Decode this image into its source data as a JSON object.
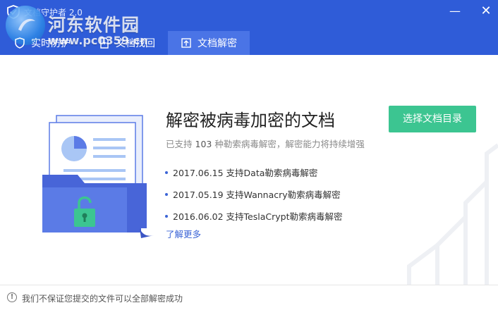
{
  "window": {
    "title": "文档守护者 2.0",
    "minimize_symbol": "—",
    "close_symbol": "✕"
  },
  "watermark": {
    "title": "河东软件园",
    "url": "www.pc0359.cn"
  },
  "tabs": [
    {
      "label": "实时防护",
      "icon": "shield-icon",
      "active": false
    },
    {
      "label": "文档找回",
      "icon": "document-recover-icon",
      "active": false
    },
    {
      "label": "文档解密",
      "icon": "unlock-document-icon",
      "active": true
    }
  ],
  "main": {
    "heading": "解密被病毒加密的文档",
    "subtitle_prefix": "已支持",
    "subtitle_count": "103",
    "subtitle_suffix": "种勒索病毒解密，解密能力将持续增强",
    "select_button": "选择文档目录",
    "support_items": [
      "2017.06.15 支持Data勒索病毒解密",
      "2017.05.19 支持Wannacry勒索病毒解密",
      "2016.06.02 支持TeslaCrypt勒索病毒解密"
    ],
    "more_link": "了解更多"
  },
  "footer": {
    "icon": "warning-icon",
    "icon_glyph": "!",
    "text": "我们不保证您提交的文件可以全部解密成功"
  },
  "colors": {
    "header_bg": "#2f5cd8",
    "active_tab_bg": "#4a74e6",
    "primary_button": "#3cc591",
    "link": "#3b64d6",
    "folder_blue": "#5b7be6",
    "lock_green": "#3cc591"
  }
}
